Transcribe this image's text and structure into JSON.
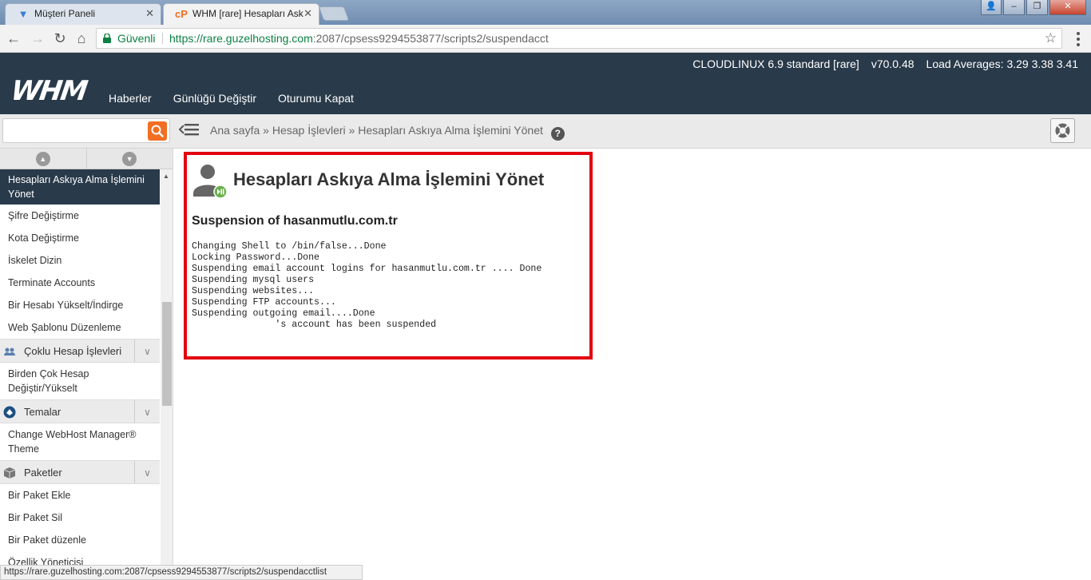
{
  "browser": {
    "tabs": [
      {
        "title": "Müşteri Paneli",
        "active": false
      },
      {
        "title": "WHM [rare] Hesapları Ask",
        "active": true
      }
    ],
    "secure_label": "Güvenli",
    "url_host": "https://rare.guzelhosting.com",
    "url_rest": ":2087/cpsess9294553877/scripts2/suspendacct",
    "status_url": "https://rare.guzelhosting.com:2087/cpsess9294553877/scripts2/suspendacctlist"
  },
  "header": {
    "os": "CLOUDLINUX 6.9 standard [rare]",
    "version": "v70.0.48",
    "load": "Load Averages: 3.29 3.38 3.41",
    "logo": "WHM",
    "nav": [
      "Haberler",
      "Günlüğü Değiştir",
      "Oturumu Kapat"
    ]
  },
  "breadcrumb": {
    "items": [
      "Ana sayfa",
      "Hesap İşlevleri",
      "Hesapları Askıya Alma İşlemini Yönet"
    ],
    "separator": "»"
  },
  "sidebar": {
    "active_item": "Hesapları Askıya Alma İşlemini Yönet",
    "items_account": [
      "Şifre Değiştirme",
      "Kota Değiştirme",
      "İskelet Dizin",
      "Terminate Accounts",
      "Bir Hesabı Yükselt/İndirge",
      "Web Şablonu Düzenleme"
    ],
    "cat_multi": "Çoklu Hesap İşlevleri",
    "items_multi": [
      "Birden Çok Hesap Değiştir/Yükselt"
    ],
    "cat_themes": "Temalar",
    "items_themes": [
      "Change WebHost Manager® Theme"
    ],
    "cat_packages": "Paketler",
    "items_packages": [
      "Bir Paket Ekle",
      "Bir Paket Sil",
      "Bir Paket düzenle",
      "Özellik Yöneticisi"
    ]
  },
  "main": {
    "title": "Hesapları Askıya Alma İşlemini Yönet",
    "subtitle": "Suspension of hasanmutlu.com.tr",
    "log": "Changing Shell to /bin/false...Done\nLocking Password...Done\nSuspending email account logins for hasanmutlu.com.tr .... Done\nSuspending mysql users\nSuspending websites...\nSuspending FTP accounts...\nSuspending outgoing email....Done\n               's account has been suspended"
  },
  "colors": {
    "header_bg": "#293a4a",
    "accent_orange": "#f16e22",
    "highlight_red": "#e3000f",
    "secure_green": "#0b8043"
  }
}
